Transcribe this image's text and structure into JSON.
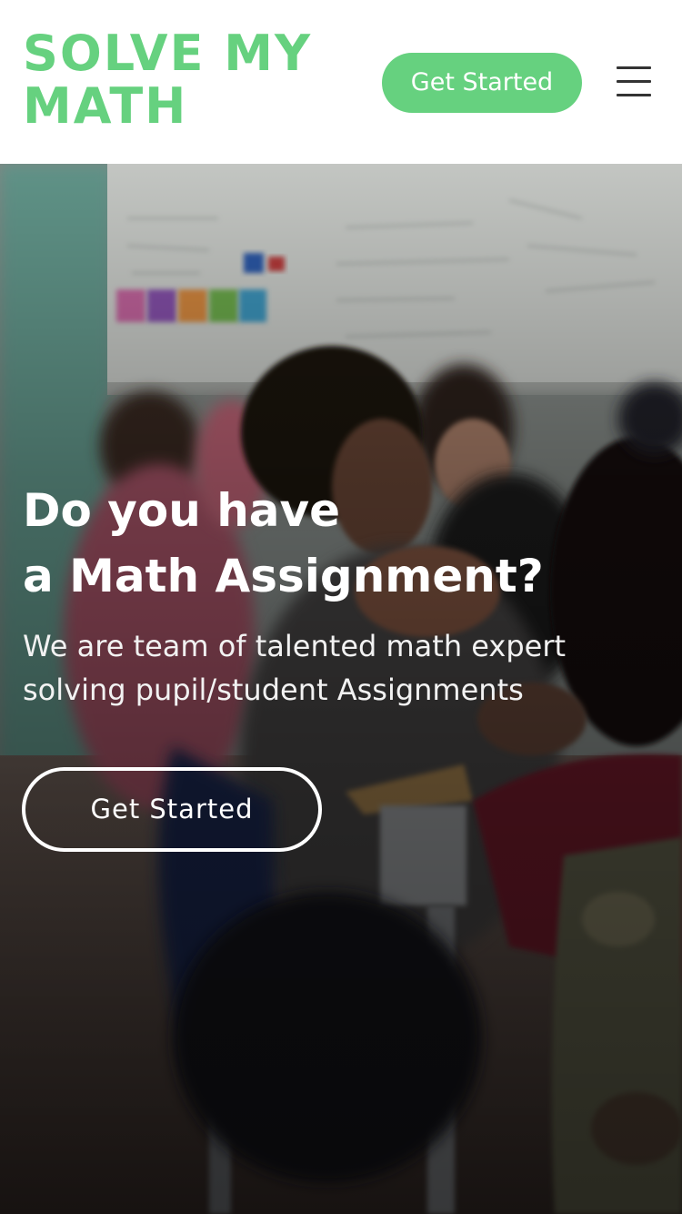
{
  "brand": {
    "name_line1": "SOLVE MY",
    "name_line2": "MATH"
  },
  "header": {
    "cta_label": "Get Started",
    "menu_icon": "hamburger-menu-icon"
  },
  "hero": {
    "background": "classroom-photo",
    "title_line1": "Do you have",
    "title_line2": "a Math Assignment?",
    "subtitle_line1": "We are team of talented math expert",
    "subtitle_line2": "solving pupil/student Assignments",
    "cta_label": "Get Started"
  },
  "colors": {
    "brand_green": "#66d17f",
    "menu_icon": "#333333",
    "hero_text": "#ffffff"
  }
}
